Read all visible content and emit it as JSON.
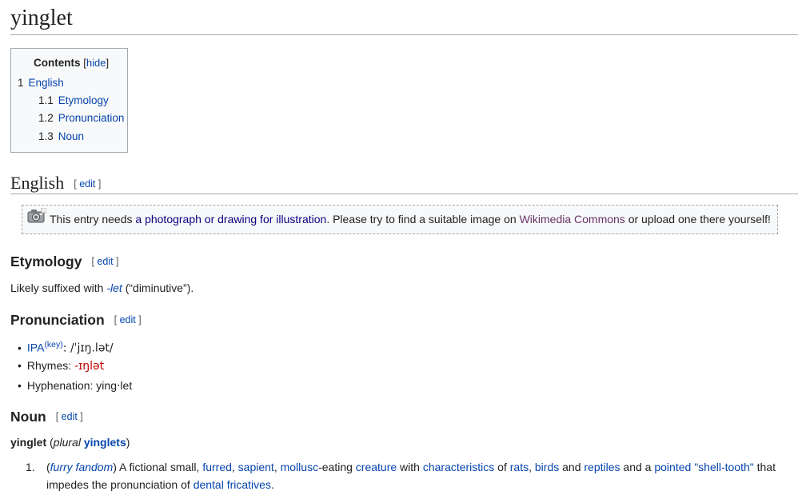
{
  "title": "yinglet",
  "toc": {
    "heading": "Contents",
    "hide_label": "hide",
    "items": [
      {
        "num": "1",
        "label": "English"
      },
      {
        "num": "1.1",
        "label": "Etymology"
      },
      {
        "num": "1.2",
        "label": "Pronunciation"
      },
      {
        "num": "1.3",
        "label": "Noun"
      }
    ]
  },
  "edit_label": "edit",
  "english": {
    "heading": "English",
    "notice": {
      "text1": "This entry needs ",
      "link1": "a photograph or drawing for illustration",
      "text2": ". Please try to find a suitable image on ",
      "link2": "Wikimedia Commons",
      "text3": " or upload one there yourself!"
    }
  },
  "etymology": {
    "heading": "Etymology",
    "text1": "Likely suffixed with ",
    "link": "-let",
    "text2": " (“diminutive”)."
  },
  "pronunciation": {
    "heading": "Pronunciation",
    "ipa_link": "IPA",
    "ipa_key": "(key)",
    "ipa_value": ": /ˈjɪŋ.lət/",
    "rhymes_label": "Rhymes: ",
    "rhymes_value": "-ɪŋlət",
    "hyphenation": "Hyphenation: ying‧let"
  },
  "noun": {
    "heading": "Noun",
    "headword": "yinglet",
    "plural_open": " (",
    "plural_label": "plural",
    "plural_form": "yinglets",
    "plural_close": ")",
    "definition": {
      "number": "1.",
      "parts": [
        {
          "t": "(",
          "k": "text"
        },
        {
          "t": "furry fandom",
          "k": "label"
        },
        {
          "t": ") A fictional small, ",
          "k": "text"
        },
        {
          "t": "furred",
          "k": "link"
        },
        {
          "t": ", ",
          "k": "text"
        },
        {
          "t": "sapient",
          "k": "link"
        },
        {
          "t": ", ",
          "k": "text"
        },
        {
          "t": "mollusc",
          "k": "link"
        },
        {
          "t": "-eating ",
          "k": "text"
        },
        {
          "t": "creature",
          "k": "link"
        },
        {
          "t": " with ",
          "k": "text"
        },
        {
          "t": "characteristics",
          "k": "link"
        },
        {
          "t": " of ",
          "k": "text"
        },
        {
          "t": "rats",
          "k": "link"
        },
        {
          "t": ", ",
          "k": "text"
        },
        {
          "t": "birds",
          "k": "link"
        },
        {
          "t": " and ",
          "k": "text"
        },
        {
          "t": "reptiles",
          "k": "link"
        },
        {
          "t": " and a ",
          "k": "text"
        },
        {
          "t": "pointed",
          "k": "link"
        },
        {
          "t": " ",
          "k": "text"
        },
        {
          "t": "\"shell-tooth\"",
          "k": "link"
        },
        {
          "t": " that impedes the pronunciation of ",
          "k": "text"
        },
        {
          "t": "dental fricatives",
          "k": "link"
        },
        {
          "t": ".",
          "k": "text"
        }
      ]
    }
  }
}
